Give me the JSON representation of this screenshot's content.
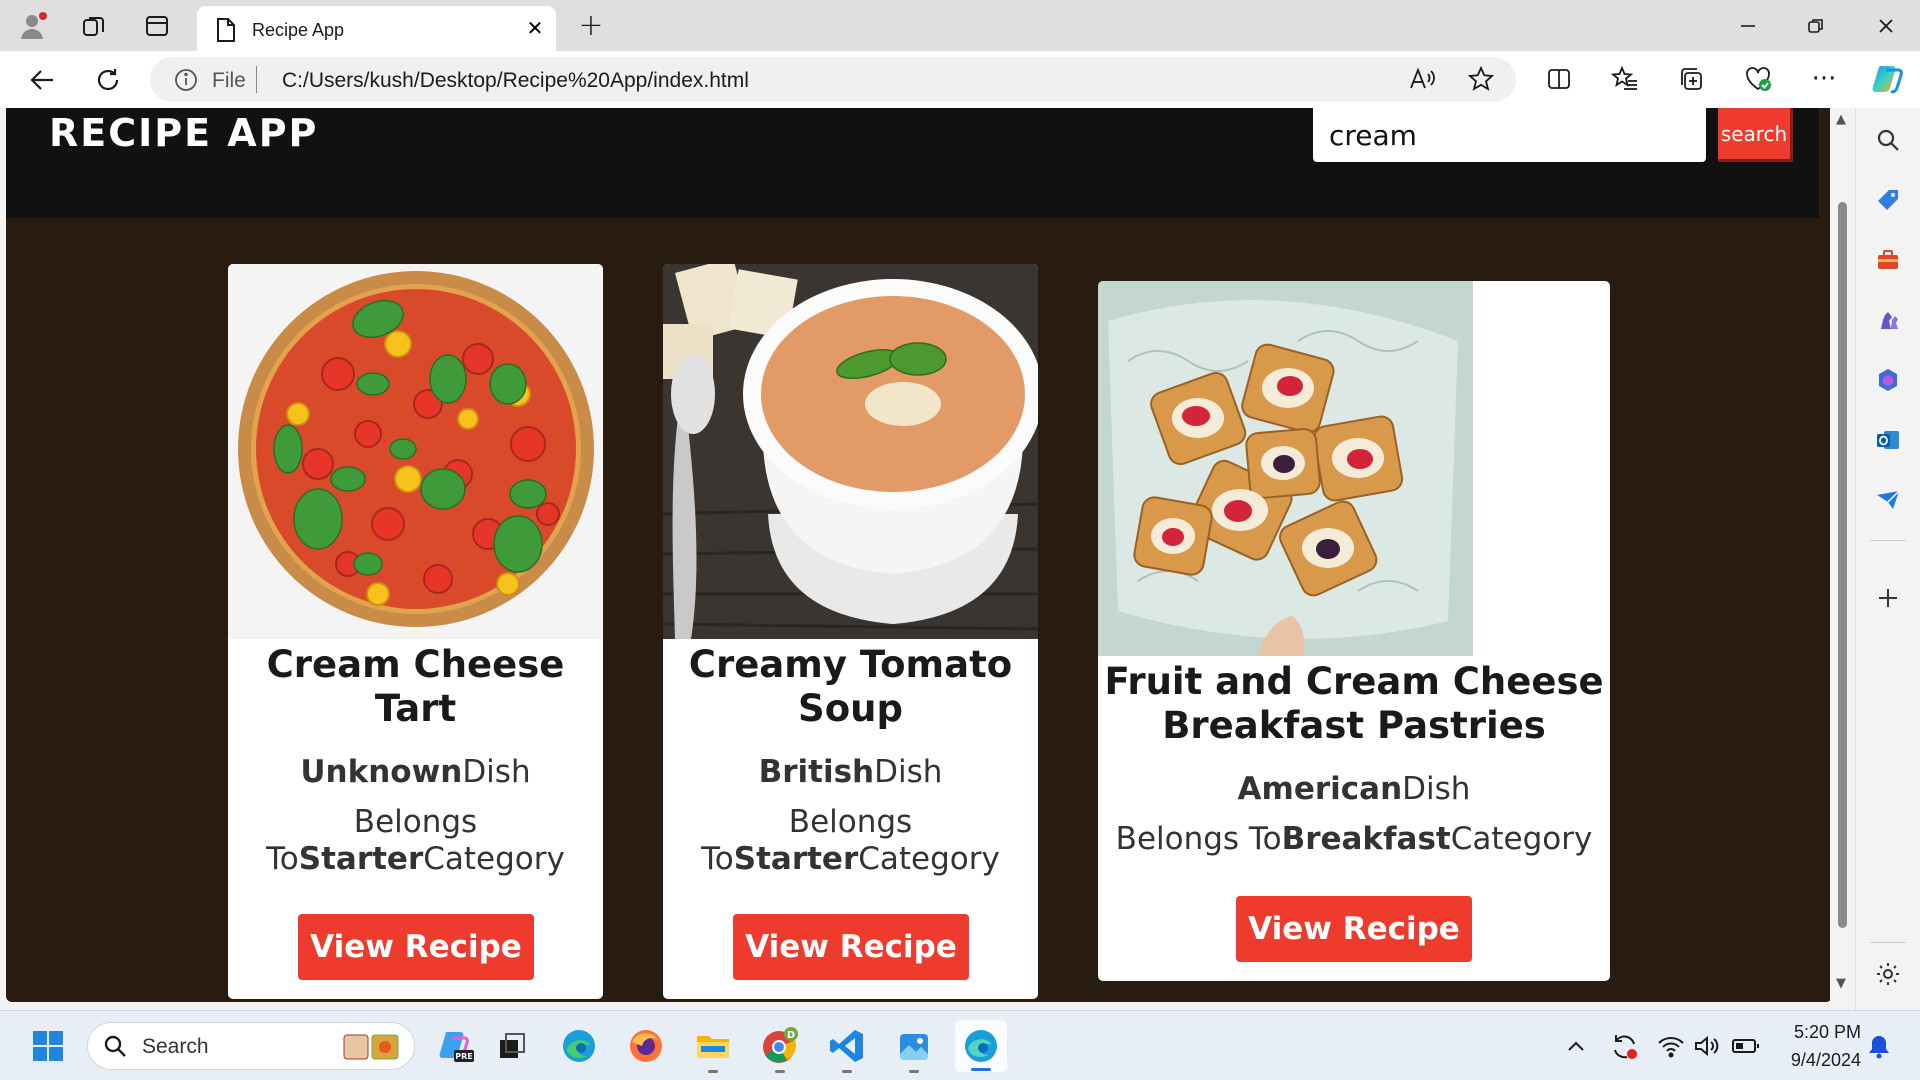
{
  "browser": {
    "tab_title": "Recipe App",
    "address_prefix": "File",
    "url": "C:/Users/kush/Desktop/Recipe%20App/index.html"
  },
  "site": {
    "title": "RECIPE APP",
    "search_value": "cream",
    "search_button": "search"
  },
  "recipes": [
    {
      "name": "Cream Cheese Tart",
      "area": "Unknown",
      "area_suffix": "Dish",
      "category_prefix": "Belongs To",
      "category": "Starter",
      "category_suffix": "Category",
      "button": "View Recipe",
      "image": "tomato-tart-photo"
    },
    {
      "name": "Creamy Tomato Soup",
      "area": "British",
      "area_suffix": "Dish",
      "category_prefix": "Belongs To",
      "category": "Starter",
      "category_suffix": "Category",
      "button": "View Recipe",
      "image": "tomato-soup-photo"
    },
    {
      "name": "Fruit and Cream Cheese Breakfast Pastries",
      "area": "American",
      "area_suffix": "Dish",
      "category_prefix": "Belongs To",
      "category": "Breakfast",
      "category_suffix": "Category",
      "button": "View Recipe",
      "image": "fruit-pastries-photo"
    }
  ],
  "taskbar": {
    "search_label": "Search",
    "time": "5:20 PM",
    "date": "9/4/2024"
  },
  "colors": {
    "page_background": "#281b10",
    "header_background": "#121111",
    "accent_red": "#ef3b2d",
    "card_background": "#ffffff"
  }
}
